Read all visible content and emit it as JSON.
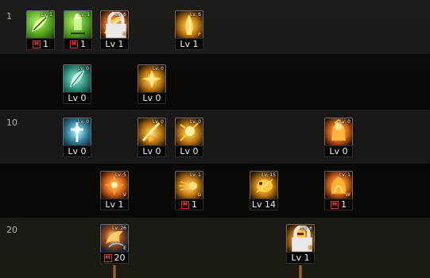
{
  "row_labels": [
    "1",
    "10",
    "20"
  ],
  "skills": [
    {
      "id": "s1",
      "theme": "green",
      "icon": "green-leaf-skill",
      "tag": "Lv. 1",
      "lock": false,
      "m": true,
      "level": "1",
      "hotkey": ""
    },
    {
      "id": "s2",
      "theme": "green",
      "icon": "green-guard-skill",
      "tag": "Lv. 1",
      "lock": false,
      "m": true,
      "level": "1",
      "hotkey": ""
    },
    {
      "id": "s3",
      "theme": "orange",
      "icon": "flame-slash-skill",
      "tag": "Lv. 6",
      "lock": true,
      "m": false,
      "level": "Lv 1",
      "hotkey": "S"
    },
    {
      "id": "s4",
      "theme": "gold",
      "icon": "flame-pillar-skill",
      "tag": "Lv. 6",
      "lock": false,
      "m": false,
      "level": "Lv 1",
      "hotkey": "F"
    },
    {
      "id": "s5",
      "theme": "teal",
      "icon": "feather-skill",
      "tag": "Lv. 0",
      "lock": false,
      "m": false,
      "level": "Lv 0",
      "hotkey": ""
    },
    {
      "id": "s6",
      "theme": "gold",
      "icon": "burst-skill",
      "tag": "Lv. 0",
      "lock": false,
      "m": false,
      "level": "Lv 0",
      "hotkey": ""
    },
    {
      "id": "s7",
      "theme": "cyan",
      "icon": "holy-cross-skill",
      "tag": "Lv. 0",
      "lock": false,
      "m": false,
      "level": "Lv 0",
      "hotkey": ""
    },
    {
      "id": "s8",
      "theme": "gold",
      "icon": "sword-flash-skill",
      "tag": "Lv. 0",
      "lock": false,
      "m": false,
      "level": "Lv 0",
      "hotkey": ""
    },
    {
      "id": "s9",
      "theme": "gold",
      "icon": "spark-skill",
      "tag": "Lv. 0",
      "lock": false,
      "m": false,
      "level": "Lv 0",
      "hotkey": ""
    },
    {
      "id": "s10",
      "theme": "orange",
      "icon": "armored-knight-skill",
      "tag": "Lv. 0",
      "lock": false,
      "m": false,
      "level": "Lv 0",
      "hotkey": ""
    },
    {
      "id": "s11",
      "theme": "orange",
      "icon": "fire-cross-skill",
      "tag": "Lv. 5",
      "lock": false,
      "m": false,
      "level": "Lv 1",
      "hotkey": "V"
    },
    {
      "id": "s12",
      "theme": "gold",
      "icon": "comet-strike-skill",
      "tag": "Lv. 1",
      "lock": false,
      "m": true,
      "level": "1",
      "hotkey": "G"
    },
    {
      "id": "s13",
      "theme": "gold",
      "icon": "golden-beast-skill",
      "tag": "Lv. 15",
      "lock": false,
      "m": false,
      "level": "Lv 14",
      "hotkey": ""
    },
    {
      "id": "s14",
      "theme": "orange",
      "icon": "flame-armor-skill",
      "tag": "Lv. 1",
      "lock": false,
      "m": true,
      "level": "1",
      "hotkey": "W"
    },
    {
      "id": "s15",
      "theme": "bluefire",
      "icon": "phoenix-skill",
      "tag": "Lv. 26",
      "lock": false,
      "m": true,
      "level": "20",
      "hotkey": "E"
    },
    {
      "id": "s16",
      "theme": "gold",
      "icon": "golden-totem-skill",
      "tag": "Lv. 6",
      "lock": true,
      "m": false,
      "level": "Lv 1",
      "hotkey": "R"
    }
  ]
}
